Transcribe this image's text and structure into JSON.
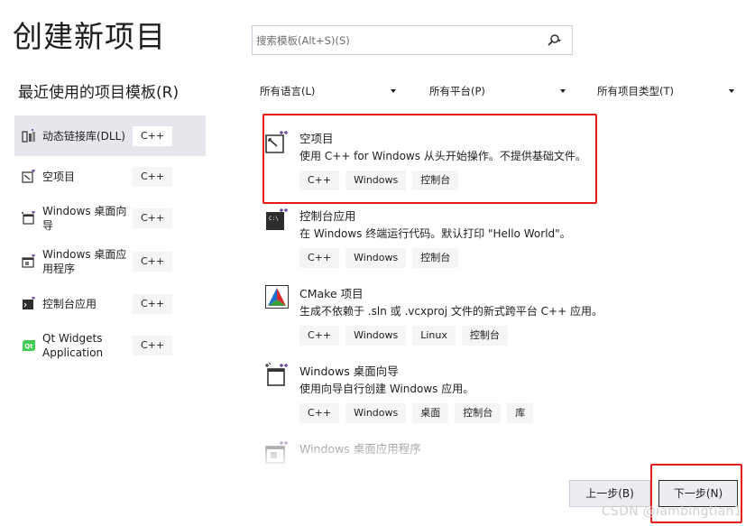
{
  "page": {
    "title": "创建新项目"
  },
  "search": {
    "placeholder": "搜索模板(Alt+S)(S)",
    "icon": "search-icon"
  },
  "recent": {
    "heading": "最近使用的项目模板(R)",
    "items": [
      {
        "label": "动态链接库(DLL)",
        "lang": "C++",
        "icon": "dll-icon",
        "selected": true
      },
      {
        "label": "空项目",
        "lang": "C++",
        "icon": "empty-project-icon"
      },
      {
        "label": "Windows 桌面向导",
        "lang": "C++",
        "icon": "desktop-wizard-icon"
      },
      {
        "label": "Windows 桌面应用程序",
        "lang": "C++",
        "icon": "desktop-app-icon"
      },
      {
        "label": "控制台应用",
        "lang": "C++",
        "icon": "console-app-icon"
      },
      {
        "label": "Qt Widgets Application",
        "lang": "C++",
        "icon": "qt-icon"
      }
    ]
  },
  "filters": {
    "language": "所有语言(L)",
    "platform": "所有平台(P)",
    "project_type": "所有项目类型(T)"
  },
  "templates": [
    {
      "name": "空项目",
      "desc": "使用 C++ for Windows 从头开始操作。不提供基础文件。",
      "tags": [
        "C++",
        "Windows",
        "控制台"
      ],
      "icon": "empty-project-icon"
    },
    {
      "name": "控制台应用",
      "desc": "在 Windows 终端运行代码。默认打印 \"Hello World\"。",
      "tags": [
        "C++",
        "Windows",
        "控制台"
      ],
      "icon": "console-app-icon"
    },
    {
      "name": "CMake 项目",
      "desc": "生成不依赖于 .sln 或 .vcxproj 文件的新式跨平台 C++ 应用。",
      "tags": [
        "C++",
        "Windows",
        "Linux",
        "控制台"
      ],
      "icon": "cmake-icon"
    },
    {
      "name": "Windows 桌面向导",
      "desc": "使用向导自行创建 Windows 应用。",
      "tags": [
        "C++",
        "Windows",
        "桌面",
        "控制台",
        "库"
      ],
      "icon": "desktop-wizard-icon"
    },
    {
      "name": "Windows 桌面应用程序",
      "desc": "",
      "tags": [],
      "icon": "desktop-app-icon"
    }
  ],
  "buttons": {
    "prev": "上一步(B)",
    "next": "下一步(N)"
  },
  "watermark": "CSDN @iambingtian1",
  "colors": {
    "highlight_red": "#e81a1a",
    "selected_bg": "#e6e7ed",
    "tag_bg": "#f5f5f5",
    "qt_green": "#41cd52"
  }
}
